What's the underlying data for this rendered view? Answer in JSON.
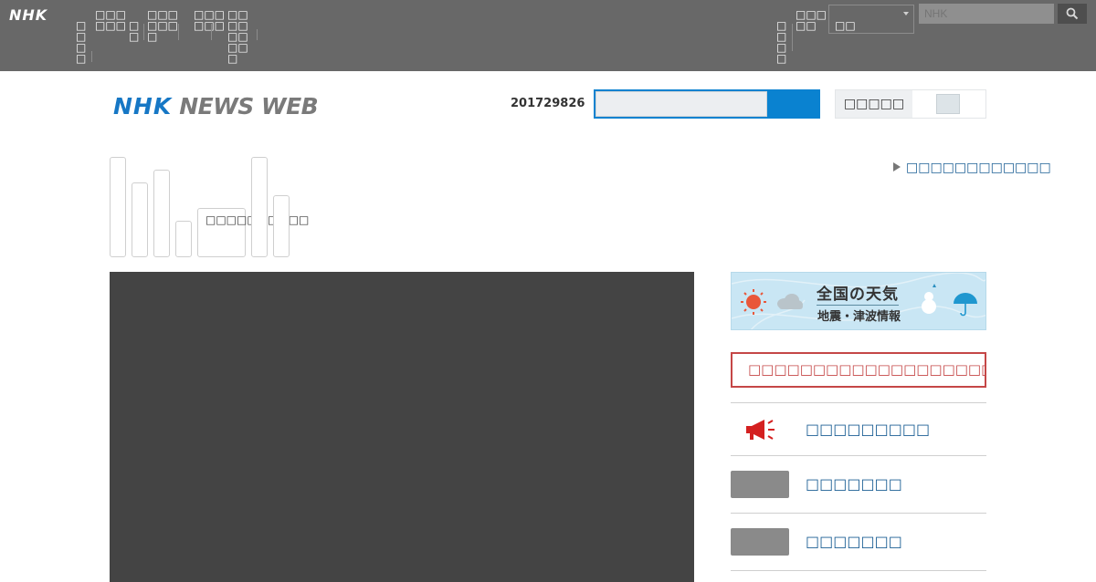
{
  "global_bar": {
    "logo": "NHK",
    "nav_items": [
      "□□□□",
      "□□□□□□",
      "□□",
      "□□□□□□□",
      "□□□□□□",
      "□□□□□□□□□"
    ],
    "right_items": [
      "□□□□",
      "□□□□□"
    ],
    "language_select": "□□",
    "search_placeholder": "NHK"
  },
  "header": {
    "logo_nhk": "NHK",
    "logo_news_web": "NEWS WEB",
    "number": "201729826",
    "toggle_label": "□□□□□"
  },
  "subnav": {
    "tab_label": "□□□□□□□□□□",
    "top_link": "□□□□□□□□□□□□"
  },
  "sidebar": {
    "weather_title": "全国の天気",
    "weather_sub": "地震・津波情報",
    "alert_text": "□□□□□□□□□□□□□□□□□□□□□",
    "items": [
      {
        "label": "□□□□□□□□□"
      },
      {
        "label": "□□□□□□□"
      },
      {
        "label": "□□□□□□□"
      }
    ]
  },
  "colors": {
    "brand_blue": "#1677c5",
    "search_blue": "#0a82d0",
    "alert_red": "#c54747",
    "link_blue": "#1b5e94"
  },
  "icons": [
    "search-icon",
    "sun-icon",
    "cloud-icon",
    "snowman-icon",
    "umbrella-icon",
    "megaphone-icon"
  ]
}
